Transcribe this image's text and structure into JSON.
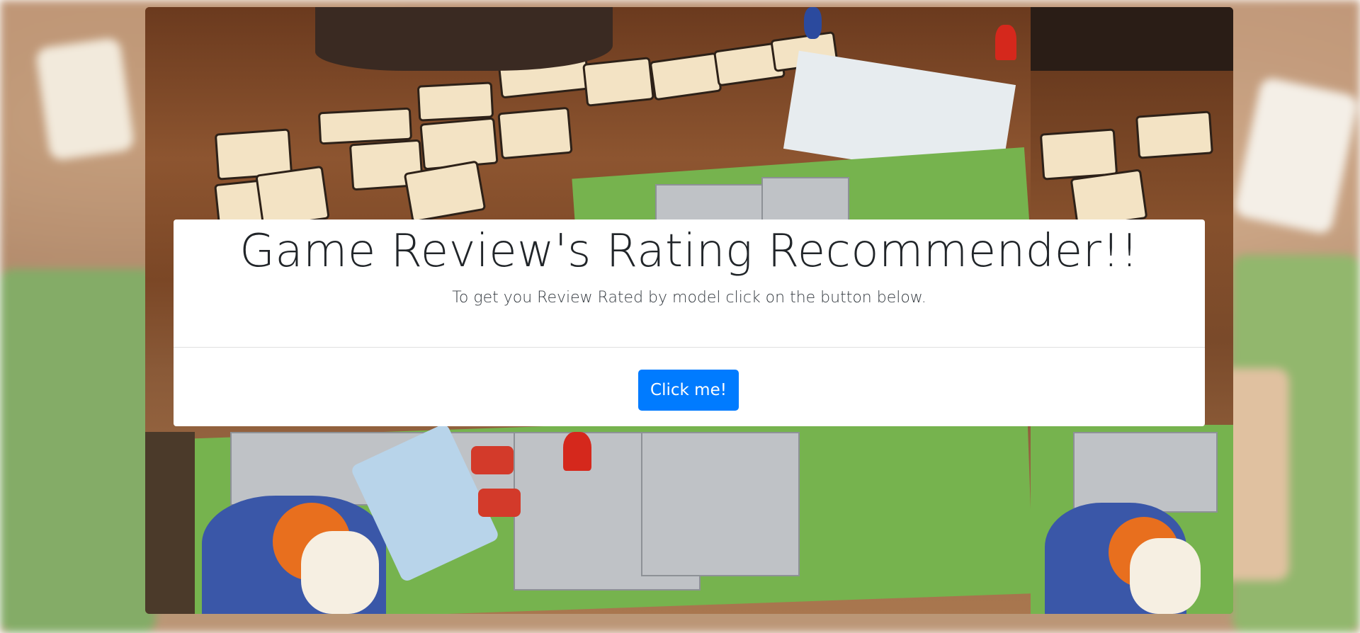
{
  "hero": {
    "title": "Game Review's Rating Recommender!!",
    "subtitle": "To get you Review Rated by model click on the button below.",
    "button_label": "Click me!"
  },
  "colors": {
    "button": "#007bff",
    "panel": "#ffffff",
    "title_text": "#212529"
  }
}
